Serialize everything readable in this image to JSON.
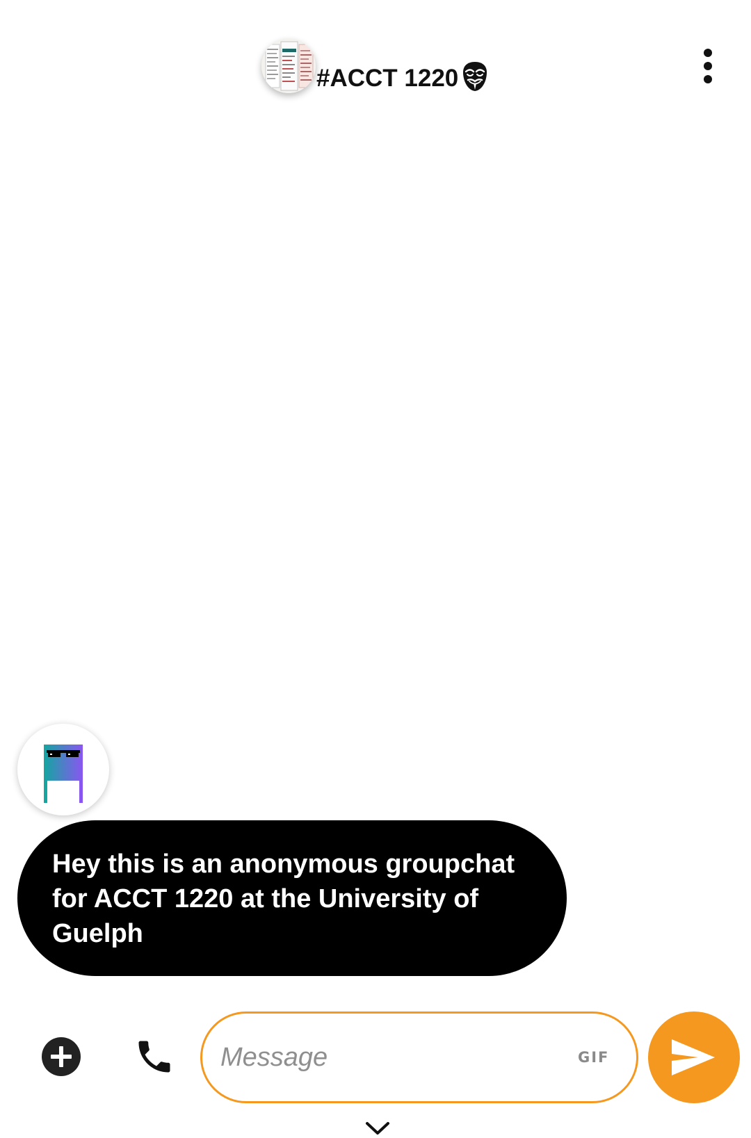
{
  "header": {
    "group_name": "#ACCT 1220",
    "avatar_icon": "group-photo-avatar",
    "badge_icon": "anonymous-mask-icon",
    "menu_icon": "more-vertical-icon"
  },
  "messages": [
    {
      "sender_avatar_icon": "pixel-sunglasses-avatar",
      "text": "Hey this is an anonymous groupchat for ACCT 1220 at the University of Guelph"
    }
  ],
  "composer": {
    "placeholder": "Message",
    "gif_label": "GIF",
    "add_icon": "plus-circle-icon",
    "call_icon": "phone-icon",
    "send_icon": "send-icon",
    "collapse_icon": "chevron-down-icon"
  },
  "colors": {
    "accent": "#f5981f",
    "bubble": "#000000",
    "bubble_text": "#ffffff",
    "placeholder": "#8f8f8f"
  }
}
